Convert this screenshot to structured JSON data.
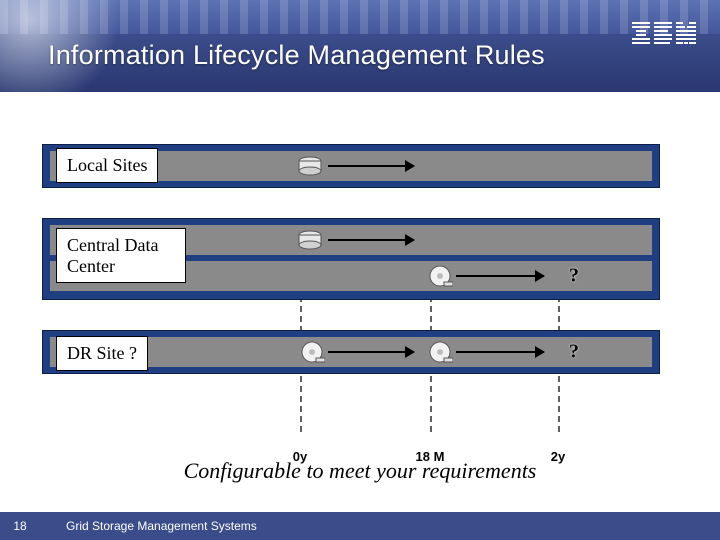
{
  "header": {
    "title": "Information Lifecycle Management Rules",
    "logo_name": "ibm-logo"
  },
  "timeline": {
    "ticks": [
      "0y",
      "18 M",
      "2y"
    ]
  },
  "sites": [
    {
      "name": "Local Sites",
      "tiers": [
        "SATA"
      ]
    },
    {
      "name": "Central Data Center",
      "tiers": [
        "SATA",
        "Tape"
      ]
    },
    {
      "name": "DR Site ?",
      "tiers": [
        "Tape"
      ]
    }
  ],
  "subtitle": "Configurable to meet your requirements",
  "footer": {
    "page": "18",
    "caption": "Grid Storage Management Systems"
  },
  "colors": {
    "header": "#3a4c8a",
    "block": "#1f3f82",
    "row": "#8a8a8a"
  }
}
